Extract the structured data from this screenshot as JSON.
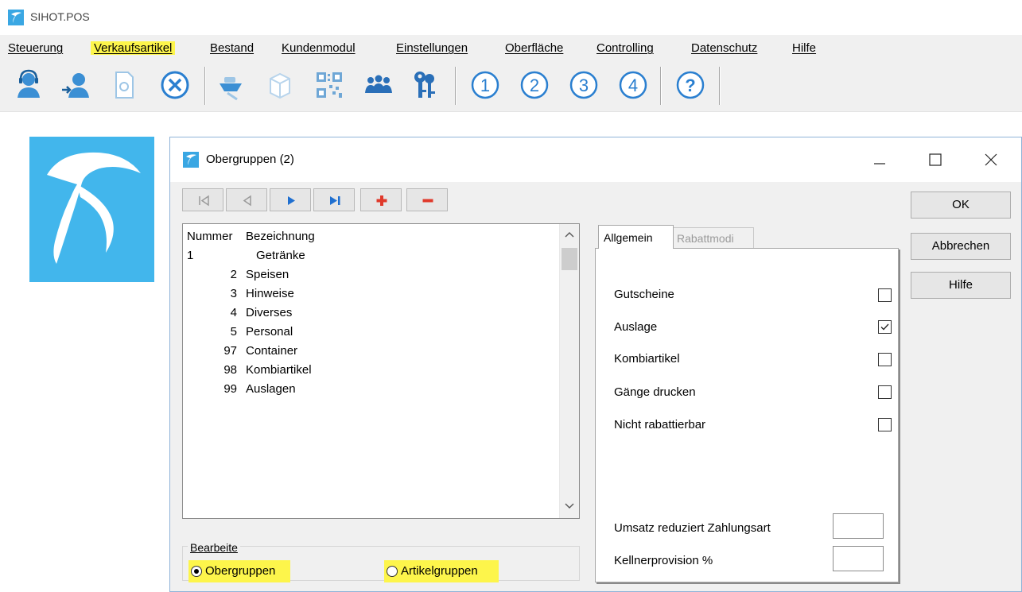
{
  "app": {
    "title": "SIHOT.POS"
  },
  "menu": [
    {
      "label": "Steuerung",
      "highlighted": false
    },
    {
      "label": "Verkaufsartikel",
      "highlighted": true
    },
    {
      "label": "Bestand",
      "highlighted": false
    },
    {
      "label": "Kundenmodul",
      "highlighted": false
    },
    {
      "label": "Einstellungen",
      "highlighted": false
    },
    {
      "label": "Oberfläche",
      "highlighted": false
    },
    {
      "label": "Controlling",
      "highlighted": false
    },
    {
      "label": "Datenschutz",
      "highlighted": false
    },
    {
      "label": "Hilfe",
      "highlighted": false
    }
  ],
  "toolbar": {
    "icons": [
      "user-headset-icon",
      "user-login-icon",
      "document-settings-icon",
      "cancel-circle-icon",
      "soap-dish-icon",
      "package-icon",
      "qr-code-icon",
      "group-users-icon",
      "keys-icon",
      "number-1-icon",
      "number-2-icon",
      "number-3-icon",
      "number-4-icon",
      "help-icon"
    ],
    "numbers": [
      "1",
      "2",
      "3",
      "4"
    ],
    "help_symbol": "?"
  },
  "dialog": {
    "title": "Obergruppen (2)",
    "window_controls": [
      "minimize",
      "maximize",
      "close"
    ],
    "nav_buttons": [
      "first",
      "previous",
      "next",
      "last",
      "add",
      "remove"
    ],
    "list": {
      "headers": {
        "number": "Nummer",
        "name": "Bezeichnung"
      },
      "rows": [
        {
          "number": "1",
          "name": "Getränke",
          "align": "left"
        },
        {
          "number": "2",
          "name": "Speisen",
          "align": "right"
        },
        {
          "number": "3",
          "name": "Hinweise",
          "align": "right"
        },
        {
          "number": "4",
          "name": "Diverses",
          "align": "right"
        },
        {
          "number": "5",
          "name": "Personal",
          "align": "right"
        },
        {
          "number": "97",
          "name": "Container",
          "align": "right"
        },
        {
          "number": "98",
          "name": "Kombiartikel",
          "align": "right"
        },
        {
          "number": "99",
          "name": "Auslagen",
          "align": "right"
        }
      ]
    },
    "group": {
      "label": "Bearbeite",
      "options": [
        {
          "label": "Obergruppen",
          "selected": true
        },
        {
          "label": "Artikelgruppen",
          "selected": false
        }
      ]
    },
    "tabs": [
      {
        "label": "Allgemein",
        "active": true
      },
      {
        "label": "Rabattmodi",
        "active": false
      }
    ],
    "options": [
      {
        "label": "Gutscheine",
        "checked": false
      },
      {
        "label": "Auslage",
        "checked": true
      },
      {
        "label": "Kombiartikel",
        "checked": false
      },
      {
        "label": "Gänge drucken",
        "checked": false
      },
      {
        "label": "Nicht rabattierbar",
        "checked": false
      }
    ],
    "fields": [
      {
        "label": "Umsatz reduziert Zahlungsart",
        "value": ""
      },
      {
        "label": "Kellnerprovision %",
        "value": ""
      }
    ],
    "buttons": {
      "ok": "OK",
      "cancel": "Abbrechen",
      "help": "Hilfe"
    }
  },
  "colors": {
    "highlight": "#fdf54b",
    "brand": "#42b6ec",
    "nav_blue": "#1f6fd0",
    "nav_red": "#e0392b"
  }
}
